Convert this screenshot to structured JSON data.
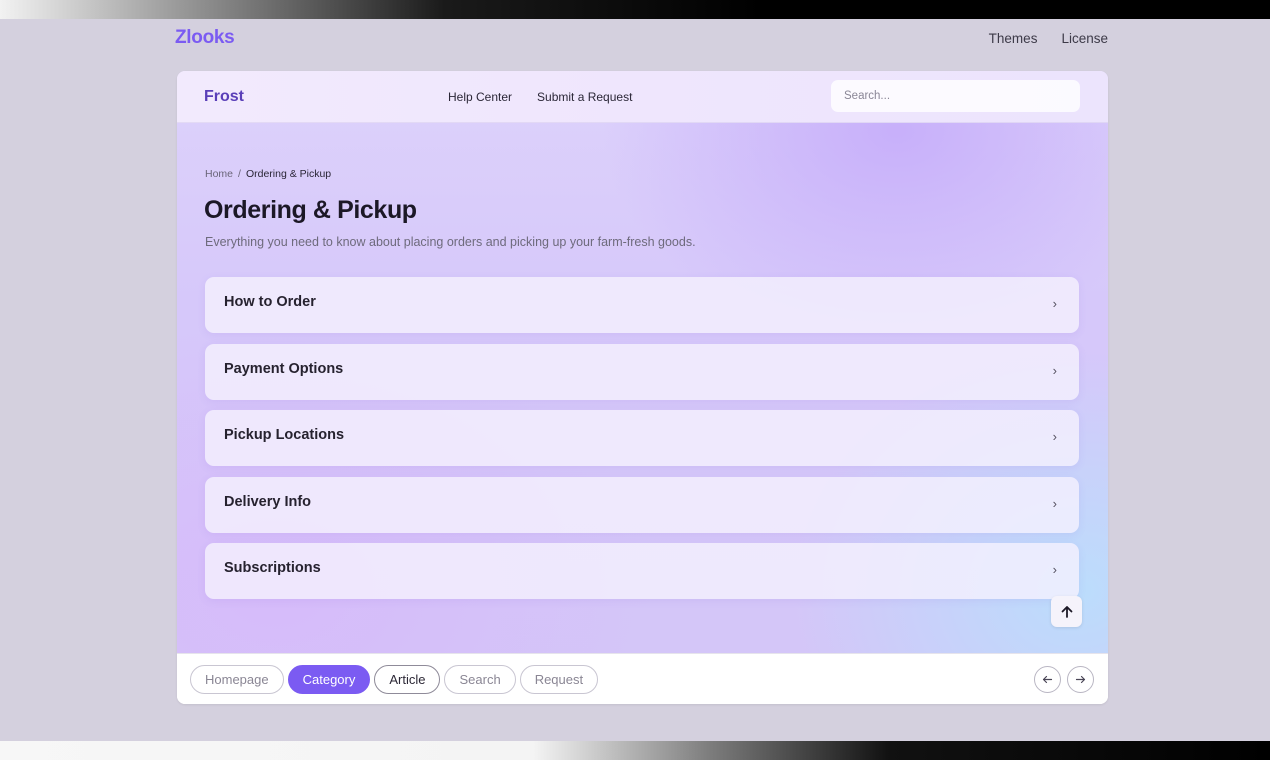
{
  "site": {
    "brand": "Zlooks",
    "nav": [
      "Themes",
      "License"
    ]
  },
  "preview": {
    "logo": "Frost",
    "nav": [
      "Help Center",
      "Submit a Request"
    ],
    "search_placeholder": "Search...",
    "breadcrumb": {
      "home": "Home",
      "separator": "/",
      "current": "Ordering & Pickup"
    },
    "title": "Ordering & Pickup",
    "description": "Everything you need to know about placing orders and picking up your farm-fresh goods.",
    "sections": [
      {
        "label": "How to Order",
        "icon": "chevron-right-icon"
      },
      {
        "label": "Payment Options",
        "icon": "chevron-right-icon"
      },
      {
        "label": "Pickup Locations",
        "icon": "chevron-right-icon"
      },
      {
        "label": "Delivery Info",
        "icon": "chevron-right-icon"
      },
      {
        "label": "Subscriptions",
        "icon": "chevron-right-icon"
      }
    ],
    "scroll_top_icon": "arrow-up-icon"
  },
  "tabbar": {
    "tabs": [
      "Homepage",
      "Category",
      "Article",
      "Search",
      "Request"
    ],
    "active_tab": "Category",
    "prev_icon": "arrow-left-icon",
    "next_icon": "arrow-right-icon"
  },
  "colors": {
    "accent": "#7b5bf2",
    "background": "#d4d0de",
    "inner_logo": "#5a3fb8"
  }
}
